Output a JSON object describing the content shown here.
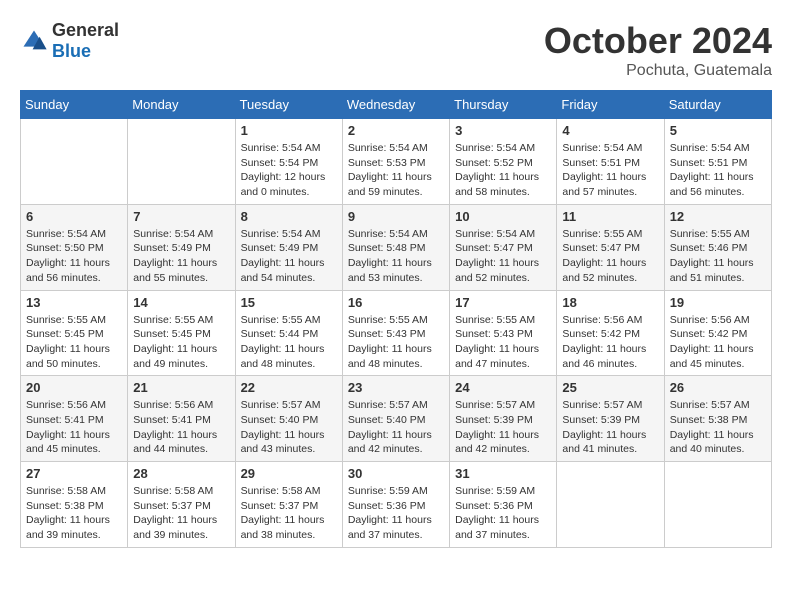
{
  "logo": {
    "general": "General",
    "blue": "Blue"
  },
  "title": "October 2024",
  "location": "Pochuta, Guatemala",
  "days_header": [
    "Sunday",
    "Monday",
    "Tuesday",
    "Wednesday",
    "Thursday",
    "Friday",
    "Saturday"
  ],
  "weeks": [
    [
      {
        "day": "",
        "info": ""
      },
      {
        "day": "",
        "info": ""
      },
      {
        "day": "1",
        "info": "Sunrise: 5:54 AM\nSunset: 5:54 PM\nDaylight: 12 hours\nand 0 minutes."
      },
      {
        "day": "2",
        "info": "Sunrise: 5:54 AM\nSunset: 5:53 PM\nDaylight: 11 hours\nand 59 minutes."
      },
      {
        "day": "3",
        "info": "Sunrise: 5:54 AM\nSunset: 5:52 PM\nDaylight: 11 hours\nand 58 minutes."
      },
      {
        "day": "4",
        "info": "Sunrise: 5:54 AM\nSunset: 5:51 PM\nDaylight: 11 hours\nand 57 minutes."
      },
      {
        "day": "5",
        "info": "Sunrise: 5:54 AM\nSunset: 5:51 PM\nDaylight: 11 hours\nand 56 minutes."
      }
    ],
    [
      {
        "day": "6",
        "info": "Sunrise: 5:54 AM\nSunset: 5:50 PM\nDaylight: 11 hours\nand 56 minutes."
      },
      {
        "day": "7",
        "info": "Sunrise: 5:54 AM\nSunset: 5:49 PM\nDaylight: 11 hours\nand 55 minutes."
      },
      {
        "day": "8",
        "info": "Sunrise: 5:54 AM\nSunset: 5:49 PM\nDaylight: 11 hours\nand 54 minutes."
      },
      {
        "day": "9",
        "info": "Sunrise: 5:54 AM\nSunset: 5:48 PM\nDaylight: 11 hours\nand 53 minutes."
      },
      {
        "day": "10",
        "info": "Sunrise: 5:54 AM\nSunset: 5:47 PM\nDaylight: 11 hours\nand 52 minutes."
      },
      {
        "day": "11",
        "info": "Sunrise: 5:55 AM\nSunset: 5:47 PM\nDaylight: 11 hours\nand 52 minutes."
      },
      {
        "day": "12",
        "info": "Sunrise: 5:55 AM\nSunset: 5:46 PM\nDaylight: 11 hours\nand 51 minutes."
      }
    ],
    [
      {
        "day": "13",
        "info": "Sunrise: 5:55 AM\nSunset: 5:45 PM\nDaylight: 11 hours\nand 50 minutes."
      },
      {
        "day": "14",
        "info": "Sunrise: 5:55 AM\nSunset: 5:45 PM\nDaylight: 11 hours\nand 49 minutes."
      },
      {
        "day": "15",
        "info": "Sunrise: 5:55 AM\nSunset: 5:44 PM\nDaylight: 11 hours\nand 48 minutes."
      },
      {
        "day": "16",
        "info": "Sunrise: 5:55 AM\nSunset: 5:43 PM\nDaylight: 11 hours\nand 48 minutes."
      },
      {
        "day": "17",
        "info": "Sunrise: 5:55 AM\nSunset: 5:43 PM\nDaylight: 11 hours\nand 47 minutes."
      },
      {
        "day": "18",
        "info": "Sunrise: 5:56 AM\nSunset: 5:42 PM\nDaylight: 11 hours\nand 46 minutes."
      },
      {
        "day": "19",
        "info": "Sunrise: 5:56 AM\nSunset: 5:42 PM\nDaylight: 11 hours\nand 45 minutes."
      }
    ],
    [
      {
        "day": "20",
        "info": "Sunrise: 5:56 AM\nSunset: 5:41 PM\nDaylight: 11 hours\nand 45 minutes."
      },
      {
        "day": "21",
        "info": "Sunrise: 5:56 AM\nSunset: 5:41 PM\nDaylight: 11 hours\nand 44 minutes."
      },
      {
        "day": "22",
        "info": "Sunrise: 5:57 AM\nSunset: 5:40 PM\nDaylight: 11 hours\nand 43 minutes."
      },
      {
        "day": "23",
        "info": "Sunrise: 5:57 AM\nSunset: 5:40 PM\nDaylight: 11 hours\nand 42 minutes."
      },
      {
        "day": "24",
        "info": "Sunrise: 5:57 AM\nSunset: 5:39 PM\nDaylight: 11 hours\nand 42 minutes."
      },
      {
        "day": "25",
        "info": "Sunrise: 5:57 AM\nSunset: 5:39 PM\nDaylight: 11 hours\nand 41 minutes."
      },
      {
        "day": "26",
        "info": "Sunrise: 5:57 AM\nSunset: 5:38 PM\nDaylight: 11 hours\nand 40 minutes."
      }
    ],
    [
      {
        "day": "27",
        "info": "Sunrise: 5:58 AM\nSunset: 5:38 PM\nDaylight: 11 hours\nand 39 minutes."
      },
      {
        "day": "28",
        "info": "Sunrise: 5:58 AM\nSunset: 5:37 PM\nDaylight: 11 hours\nand 39 minutes."
      },
      {
        "day": "29",
        "info": "Sunrise: 5:58 AM\nSunset: 5:37 PM\nDaylight: 11 hours\nand 38 minutes."
      },
      {
        "day": "30",
        "info": "Sunrise: 5:59 AM\nSunset: 5:36 PM\nDaylight: 11 hours\nand 37 minutes."
      },
      {
        "day": "31",
        "info": "Sunrise: 5:59 AM\nSunset: 5:36 PM\nDaylight: 11 hours\nand 37 minutes."
      },
      {
        "day": "",
        "info": ""
      },
      {
        "day": "",
        "info": ""
      }
    ]
  ]
}
